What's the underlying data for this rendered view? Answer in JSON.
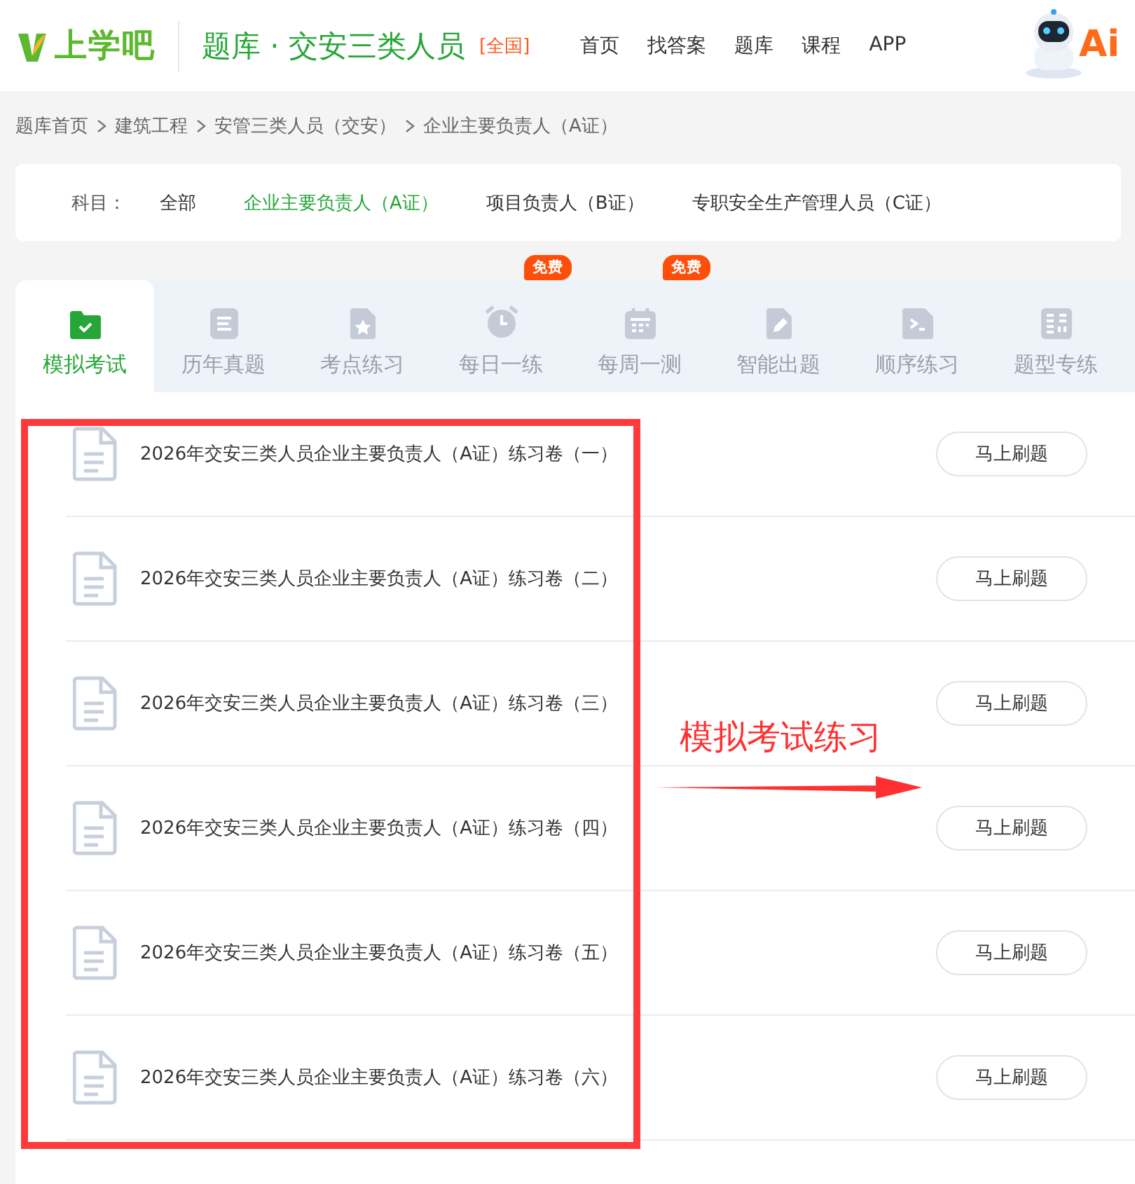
{
  "header": {
    "logo": "上学吧",
    "title": "题库 · 交安三类人员",
    "region": "[全国]",
    "nav": [
      "首页",
      "找答案",
      "题库",
      "课程",
      "APP"
    ],
    "mascot_text": "Ai"
  },
  "breadcrumb": [
    "题库首页",
    "建筑工程",
    "安管三类人员（交安）",
    "企业主要负责人（A证）"
  ],
  "subjects": {
    "label": "科目：",
    "options": [
      {
        "label": "全部",
        "selected": false
      },
      {
        "label": "企业主要负责人（A证）",
        "selected": true
      },
      {
        "label": "项目负责人（B证）",
        "selected": false
      },
      {
        "label": "专职安全生产管理人员（C证）",
        "selected": false
      }
    ]
  },
  "tabs": [
    {
      "label": "模拟考试",
      "selected": true
    },
    {
      "label": "历年真题",
      "selected": false
    },
    {
      "label": "考点练习",
      "selected": false
    },
    {
      "label": "每日一练",
      "selected": false,
      "badge": "免费"
    },
    {
      "label": "每周一测",
      "selected": false,
      "badge": "免费"
    },
    {
      "label": "智能出题",
      "selected": false
    },
    {
      "label": "顺序练习",
      "selected": false
    },
    {
      "label": "题型专练",
      "selected": false
    }
  ],
  "papers": [
    {
      "title": "2026年交安三类人员企业主要负责人（A证）练习卷（一）",
      "button": "马上刷题"
    },
    {
      "title": "2026年交安三类人员企业主要负责人（A证）练习卷（二）",
      "button": "马上刷题"
    },
    {
      "title": "2026年交安三类人员企业主要负责人（A证）练习卷（三）",
      "button": "马上刷题"
    },
    {
      "title": "2026年交安三类人员企业主要负责人（A证）练习卷（四）",
      "button": "马上刷题"
    },
    {
      "title": "2026年交安三类人员企业主要负责人（A证）练习卷（五）",
      "button": "马上刷题"
    },
    {
      "title": "2026年交安三类人员企业主要负责人（A证）练习卷（六）",
      "button": "马上刷题"
    }
  ],
  "annotation": {
    "text": "模拟考试练习"
  }
}
